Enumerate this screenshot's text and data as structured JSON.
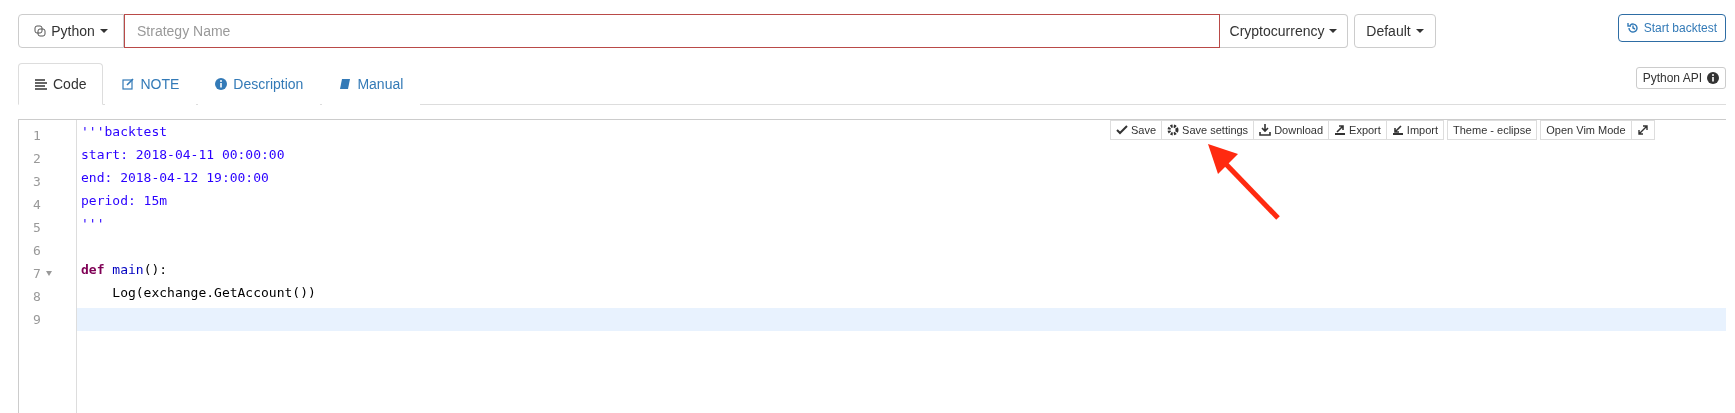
{
  "top_bar": {
    "language": "Python",
    "name_field": {
      "placeholder": "Strategy Name"
    },
    "category": "Cryptocurrency",
    "template": "Default",
    "start_button": "Start backtest"
  },
  "tabs": [
    {
      "label": "Code",
      "selected": true
    },
    {
      "label": "NOTE",
      "selected": false
    },
    {
      "label": "Description",
      "selected": false
    },
    {
      "label": "Manual",
      "selected": false
    }
  ],
  "api_button": "Python API",
  "editor": {
    "toolbar": [
      [
        "Save",
        "Save settings",
        "Download",
        "Export",
        "Import"
      ],
      [
        "Theme - eclipse"
      ],
      [
        "Open Vim Mode"
      ]
    ],
    "lines": [
      {
        "number": "1",
        "tokens": [
          {
            "kind": "string",
            "text": "'''backtest"
          }
        ]
      },
      {
        "number": "2",
        "tokens": [
          {
            "kind": "string",
            "text": "start: 2018-04-11 00:00:00"
          }
        ]
      },
      {
        "number": "3",
        "tokens": [
          {
            "kind": "string",
            "text": "end: 2018-04-12 19:00:00"
          }
        ]
      },
      {
        "number": "4",
        "tokens": [
          {
            "kind": "string",
            "text": "period: 15m"
          }
        ]
      },
      {
        "number": "5",
        "tokens": [
          {
            "kind": "string",
            "text": "'''"
          }
        ]
      },
      {
        "number": "6"
      },
      {
        "number": "7",
        "fold": true,
        "tokens": [
          {
            "kind": "keyword",
            "text": "def"
          },
          {
            "kind": "function",
            "text": " main"
          },
          {
            "kind": "plain",
            "text": "():"
          }
        ]
      },
      {
        "number": "8",
        "tokens": [
          {
            "kind": "plain",
            "text": "    Log(exchange.GetAccount())"
          }
        ]
      },
      {
        "number": "9",
        "active": true
      }
    ]
  }
}
